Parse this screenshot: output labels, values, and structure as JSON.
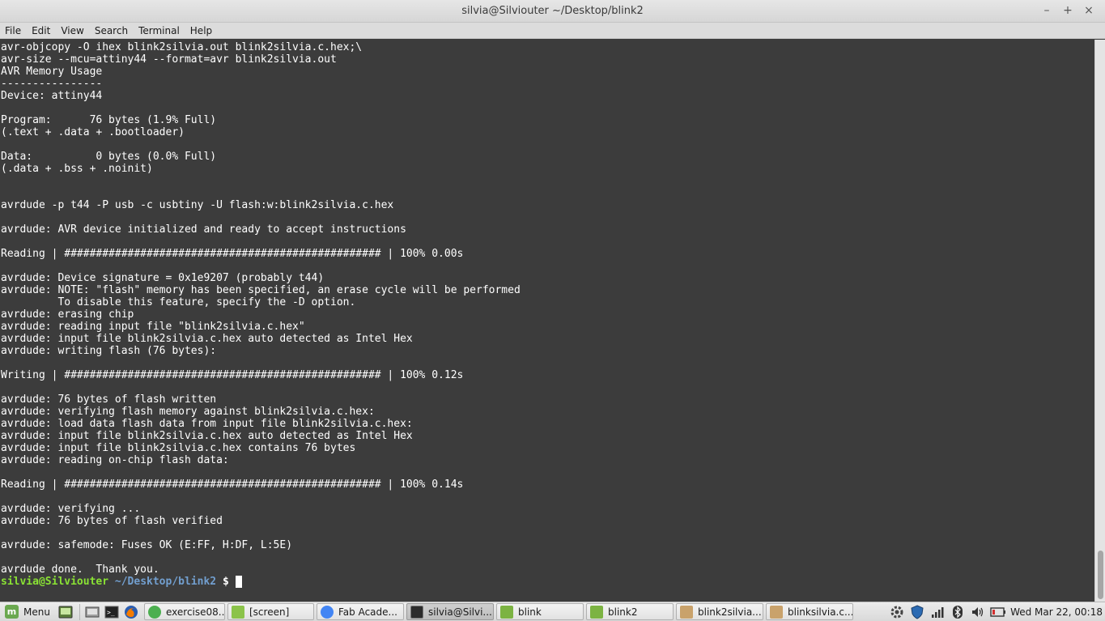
{
  "window": {
    "title": "silvia@Silviouter ~/Desktop/blink2",
    "minimize": "–",
    "maximize": "+",
    "close": "×"
  },
  "menubar": {
    "items": [
      "File",
      "Edit",
      "View",
      "Search",
      "Terminal",
      "Help"
    ]
  },
  "terminal": {
    "output": "avr-objcopy -O ihex blink2silvia.out blink2silvia.c.hex;\\\navr-size --mcu=attiny44 --format=avr blink2silvia.out\nAVR Memory Usage\n----------------\nDevice: attiny44\n\nProgram:      76 bytes (1.9% Full)\n(.text + .data + .bootloader)\n\nData:          0 bytes (0.0% Full)\n(.data + .bss + .noinit)\n\n\navrdude -p t44 -P usb -c usbtiny -U flash:w:blink2silvia.c.hex\n\navrdude: AVR device initialized and ready to accept instructions\n\nReading | ################################################## | 100% 0.00s\n\navrdude: Device signature = 0x1e9207 (probably t44)\navrdude: NOTE: \"flash\" memory has been specified, an erase cycle will be performed\n         To disable this feature, specify the -D option.\navrdude: erasing chip\navrdude: reading input file \"blink2silvia.c.hex\"\navrdude: input file blink2silvia.c.hex auto detected as Intel Hex\navrdude: writing flash (76 bytes):\n\nWriting | ################################################## | 100% 0.12s\n\navrdude: 76 bytes of flash written\navrdude: verifying flash memory against blink2silvia.c.hex:\navrdude: load data flash data from input file blink2silvia.c.hex:\navrdude: input file blink2silvia.c.hex auto detected as Intel Hex\navrdude: input file blink2silvia.c.hex contains 76 bytes\navrdude: reading on-chip flash data:\n\nReading | ################################################## | 100% 0.14s\n\navrdude: verifying ...\navrdude: 76 bytes of flash verified\n\navrdude: safemode: Fuses OK (E:FF, H:DF, L:5E)\n\navrdude done.  Thank you.\n",
    "prompt_user": "silvia@Silviouter",
    "prompt_path": "~/Desktop/blink2",
    "prompt_symbol": "$"
  },
  "taskbar": {
    "menu_label": "Menu",
    "tasks": [
      {
        "label": "exercise08...",
        "icon": "chrome-icon",
        "color": "#4caf50"
      },
      {
        "label": "[screen]",
        "icon": "folder-icon",
        "color": "#8bc34a"
      },
      {
        "label": "Fab Acade...",
        "icon": "chrome-icon",
        "color": "#4285f4"
      },
      {
        "label": "silvia@Silvi...",
        "icon": "terminal-icon",
        "color": "#2b2b2b",
        "active": true
      },
      {
        "label": "blink",
        "icon": "folder-icon",
        "color": "#7cb342"
      },
      {
        "label": "blink2",
        "icon": "folder-icon",
        "color": "#7cb342"
      },
      {
        "label": "blink2silvia...",
        "icon": "text-editor-icon",
        "color": "#c9a26b"
      },
      {
        "label": "blinksilvia.c...",
        "icon": "text-editor-icon",
        "color": "#c9a26b"
      }
    ],
    "clock": "Wed Mar 22, 00:18"
  }
}
